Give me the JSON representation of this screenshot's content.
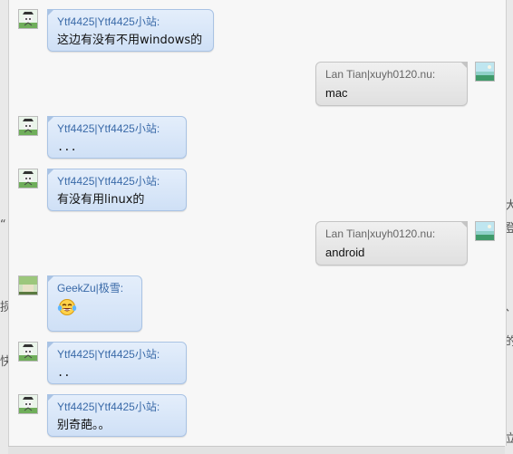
{
  "messages": [
    {
      "sender": "Ytf4425|Ytf4425小站:",
      "text": "这边有没有不用windows的",
      "side": "in",
      "avatar": "avatar-ytf"
    },
    {
      "sender": "Lan Tian|xuyh0120.nu:",
      "text": "mac",
      "side": "out",
      "avatar": "avatar-lantian"
    },
    {
      "sender": "Ytf4425|Ytf4425小站:",
      "text": "...",
      "side": "in",
      "avatar": "avatar-ytf"
    },
    {
      "sender": "Ytf4425|Ytf4425小站:",
      "text": "有没有用linux的",
      "side": "in",
      "avatar": "avatar-ytf"
    },
    {
      "sender": "Lan Tian|xuyh0120.nu:",
      "text": "android",
      "side": "out",
      "avatar": "avatar-lantian"
    },
    {
      "sender": "GeekZu|极雪:",
      "text": "",
      "emoji": "crying-laughing-emoji",
      "side": "in",
      "avatar": "avatar-geekzu"
    },
    {
      "sender": "Ytf4425|Ytf4425小站:",
      "text": "..",
      "side": "in",
      "avatar": "avatar-ytf"
    },
    {
      "sender": "Ytf4425|Ytf4425小站:",
      "text": "别奇葩。。",
      "side": "in",
      "avatar": "avatar-ytf"
    }
  ],
  "colors": {
    "incoming_bubble": "#d6e5f8",
    "outgoing_bubble": "#e6e6e6",
    "incoming_sender": "#3a6aa8",
    "outgoing_sender": "#666666"
  }
}
